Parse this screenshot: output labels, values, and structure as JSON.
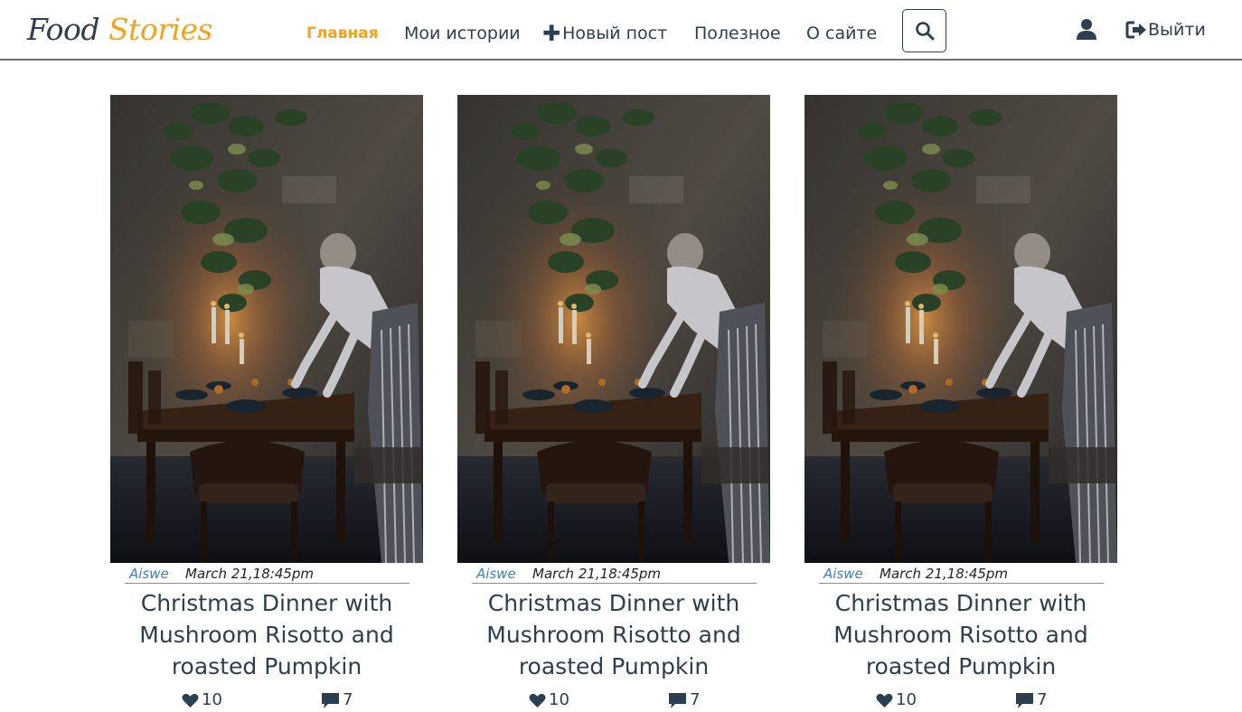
{
  "brand": {
    "word1": "Food",
    "word2": "Stories"
  },
  "nav": {
    "home": "Главная",
    "my_stories": "Мои истории",
    "new_post_icon": "plus-icon",
    "new_post": "Новый пост",
    "useful": "Полезное",
    "about": "О сайте",
    "search_icon": "search-icon",
    "user_icon": "user-icon",
    "logout_icon": "logout-icon",
    "logout": "Выйти"
  },
  "colors": {
    "accent": "#f4a21a",
    "text": "#2d3e50",
    "author_link": "#3a7fc8"
  },
  "posts": [
    {
      "author": "Aiswe",
      "date": "March 21,18:45pm",
      "title": "Christmas Dinner with Mushroom Risotto and roasted Pumpkin",
      "likes": "10",
      "comments": "7"
    },
    {
      "author": "Aiswe",
      "date": "March 21,18:45pm",
      "title": "Christmas Dinner with Mushroom Risotto and roasted Pumpkin",
      "likes": "10",
      "comments": "7"
    },
    {
      "author": "Aiswe",
      "date": "March 21,18:45pm",
      "title": "Christmas Dinner with Mushroom Risotto and roasted Pumpkin",
      "likes": "10",
      "comments": "7"
    }
  ]
}
